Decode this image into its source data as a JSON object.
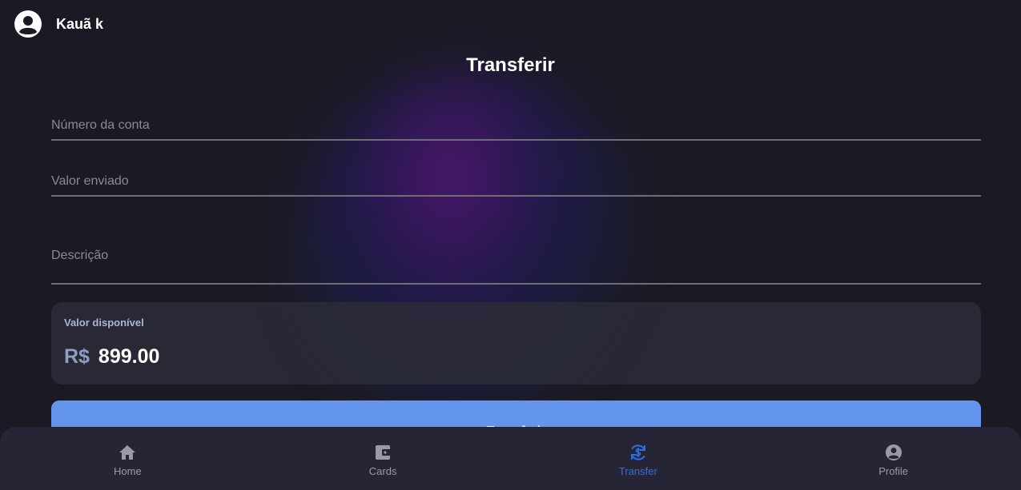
{
  "user": {
    "name": "Kauã k"
  },
  "page": {
    "title": "Transferir"
  },
  "form": {
    "account_number": {
      "placeholder": "Número da conta",
      "value": ""
    },
    "amount": {
      "placeholder": "Valor enviado",
      "value": ""
    },
    "description": {
      "placeholder": "Descrição",
      "value": ""
    }
  },
  "balance": {
    "label": "Valor disponível",
    "currency": "R$",
    "amount": "899.00"
  },
  "actions": {
    "transfer_label": "Transferir"
  },
  "nav": {
    "items": [
      {
        "label": "Home",
        "icon": "home-icon"
      },
      {
        "label": "Cards",
        "icon": "wallet-icon"
      },
      {
        "label": "Transfer",
        "icon": "transfer-icon",
        "active": true
      },
      {
        "label": "Profile",
        "icon": "profile-icon"
      }
    ]
  },
  "colors": {
    "background": "#1b1a24",
    "accent": "#6495ed",
    "nav_active": "#2f6fe8",
    "card": "#2c2b38"
  }
}
